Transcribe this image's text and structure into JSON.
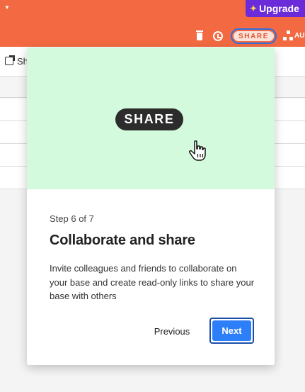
{
  "header": {
    "upgrade_label": "Upgrade",
    "share_label": "SHARE",
    "automations_label": "AU",
    "icons": [
      "trash-icon",
      "history-icon",
      "automations-icon"
    ],
    "colors": {
      "bar": "#f36a42",
      "upgrade": "#6c2bd9",
      "focus_ring": "#2f6fe0"
    }
  },
  "subtoolbar": {
    "label": "Sh"
  },
  "tour": {
    "hero_label": "SHARE",
    "step_text": "Step 6 of 7",
    "title": "Collaborate and share",
    "description": "Invite colleagues and friends to collaborate on your base and create read-only links to share your base with others",
    "previous_label": "Previous",
    "next_label": "Next",
    "colors": {
      "hero_bg": "#d3fadc",
      "primary": "#2d7ff9"
    }
  }
}
